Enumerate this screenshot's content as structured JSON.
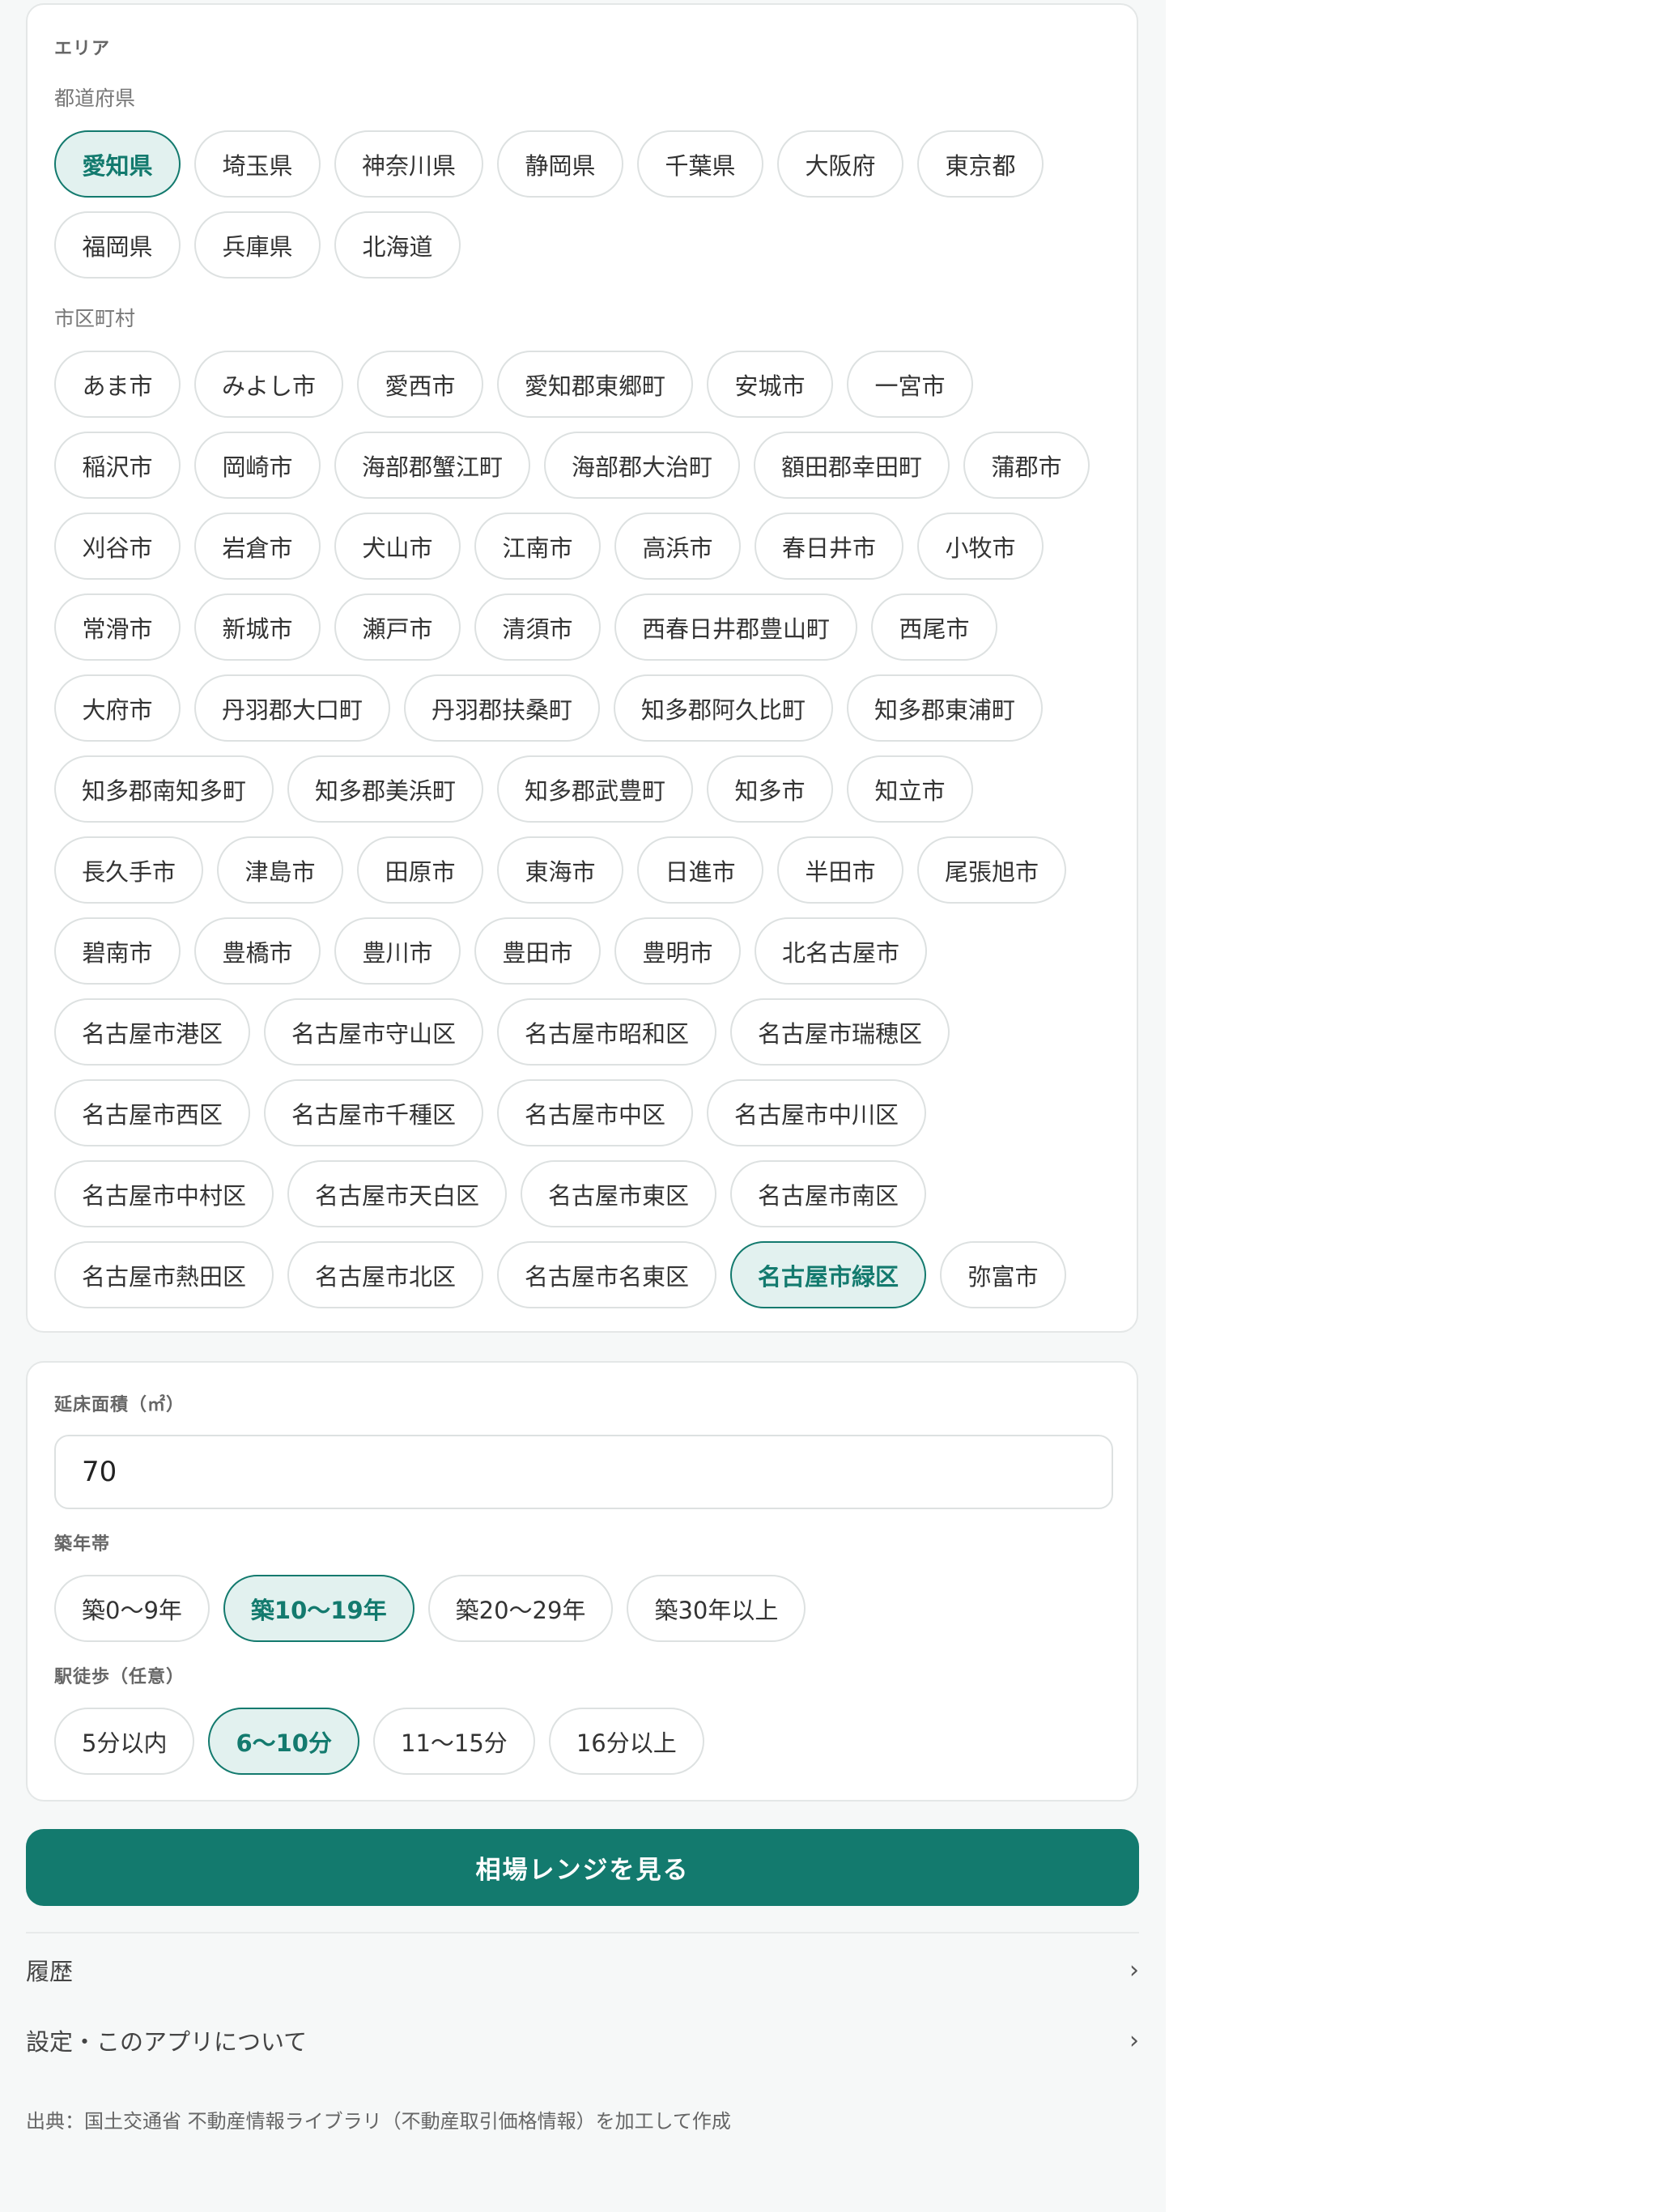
{
  "area": {
    "title": "エリア",
    "prefecture_label": "都道府県",
    "prefectures": [
      [
        {
          "label": "愛知県",
          "selected": true
        },
        {
          "label": "埼玉県"
        },
        {
          "label": "神奈川県"
        },
        {
          "label": "静岡県"
        },
        {
          "label": "千葉県"
        },
        {
          "label": "大阪府"
        },
        {
          "label": "東京都"
        }
      ],
      [
        {
          "label": "福岡県"
        },
        {
          "label": "兵庫県"
        },
        {
          "label": "北海道"
        }
      ]
    ],
    "city_label": "市区町村",
    "cities": [
      [
        {
          "label": "あま市"
        },
        {
          "label": "みよし市"
        },
        {
          "label": "愛西市"
        },
        {
          "label": "愛知郡東郷町"
        },
        {
          "label": "安城市"
        },
        {
          "label": "一宮市"
        }
      ],
      [
        {
          "label": "稲沢市"
        },
        {
          "label": "岡崎市"
        },
        {
          "label": "海部郡蟹江町"
        },
        {
          "label": "海部郡大治町"
        },
        {
          "label": "額田郡幸田町"
        },
        {
          "label": "蒲郡市"
        }
      ],
      [
        {
          "label": "刈谷市"
        },
        {
          "label": "岩倉市"
        },
        {
          "label": "犬山市"
        },
        {
          "label": "江南市"
        },
        {
          "label": "高浜市"
        },
        {
          "label": "春日井市"
        },
        {
          "label": "小牧市"
        }
      ],
      [
        {
          "label": "常滑市"
        },
        {
          "label": "新城市"
        },
        {
          "label": "瀬戸市"
        },
        {
          "label": "清須市"
        },
        {
          "label": "西春日井郡豊山町"
        },
        {
          "label": "西尾市"
        }
      ],
      [
        {
          "label": "大府市"
        },
        {
          "label": "丹羽郡大口町"
        },
        {
          "label": "丹羽郡扶桑町"
        },
        {
          "label": "知多郡阿久比町"
        },
        {
          "label": "知多郡東浦町"
        }
      ],
      [
        {
          "label": "知多郡南知多町"
        },
        {
          "label": "知多郡美浜町"
        },
        {
          "label": "知多郡武豊町"
        },
        {
          "label": "知多市"
        },
        {
          "label": "知立市"
        }
      ],
      [
        {
          "label": "長久手市"
        },
        {
          "label": "津島市"
        },
        {
          "label": "田原市"
        },
        {
          "label": "東海市"
        },
        {
          "label": "日進市"
        },
        {
          "label": "半田市"
        },
        {
          "label": "尾張旭市"
        }
      ],
      [
        {
          "label": "碧南市"
        },
        {
          "label": "豊橋市"
        },
        {
          "label": "豊川市"
        },
        {
          "label": "豊田市"
        },
        {
          "label": "豊明市"
        },
        {
          "label": "北名古屋市"
        }
      ],
      [
        {
          "label": "名古屋市港区"
        },
        {
          "label": "名古屋市守山区"
        },
        {
          "label": "名古屋市昭和区"
        },
        {
          "label": "名古屋市瑞穂区"
        }
      ],
      [
        {
          "label": "名古屋市西区"
        },
        {
          "label": "名古屋市千種区"
        },
        {
          "label": "名古屋市中区"
        },
        {
          "label": "名古屋市中川区"
        }
      ],
      [
        {
          "label": "名古屋市中村区"
        },
        {
          "label": "名古屋市天白区"
        },
        {
          "label": "名古屋市東区"
        },
        {
          "label": "名古屋市南区"
        }
      ],
      [
        {
          "label": "名古屋市熱田区"
        },
        {
          "label": "名古屋市北区"
        },
        {
          "label": "名古屋市名東区"
        },
        {
          "label": "名古屋市緑区",
          "selected": true
        },
        {
          "label": "弥富市"
        }
      ]
    ]
  },
  "conditions": {
    "floor_area_label": "延床面積（㎡）",
    "floor_area_value": "70",
    "age_label": "築年帯",
    "ages": [
      [
        {
          "label": "築0〜9年"
        },
        {
          "label": "築10〜19年",
          "selected": true
        },
        {
          "label": "築20〜29年"
        },
        {
          "label": "築30年以上"
        }
      ]
    ],
    "walk_label": "駅徒歩（任意）",
    "walks": [
      [
        {
          "label": "5分以内"
        },
        {
          "label": "6〜10分",
          "selected": true
        },
        {
          "label": "11〜15分"
        },
        {
          "label": "16分以上"
        }
      ]
    ]
  },
  "actions": {
    "submit_label": "相場レンジを見る"
  },
  "menu": {
    "history_label": "履歴",
    "settings_label": "設定・このアプリについて",
    "chevron": "›"
  },
  "footer": {
    "source": "出典：国土交通省 不動産情報ライブラリ（不動産取引価格情報）を加工して作成"
  },
  "colors": {
    "accent": "#137a6e",
    "accent_bg": "#e2f1ef",
    "page_bg": "#f6f8f8"
  }
}
